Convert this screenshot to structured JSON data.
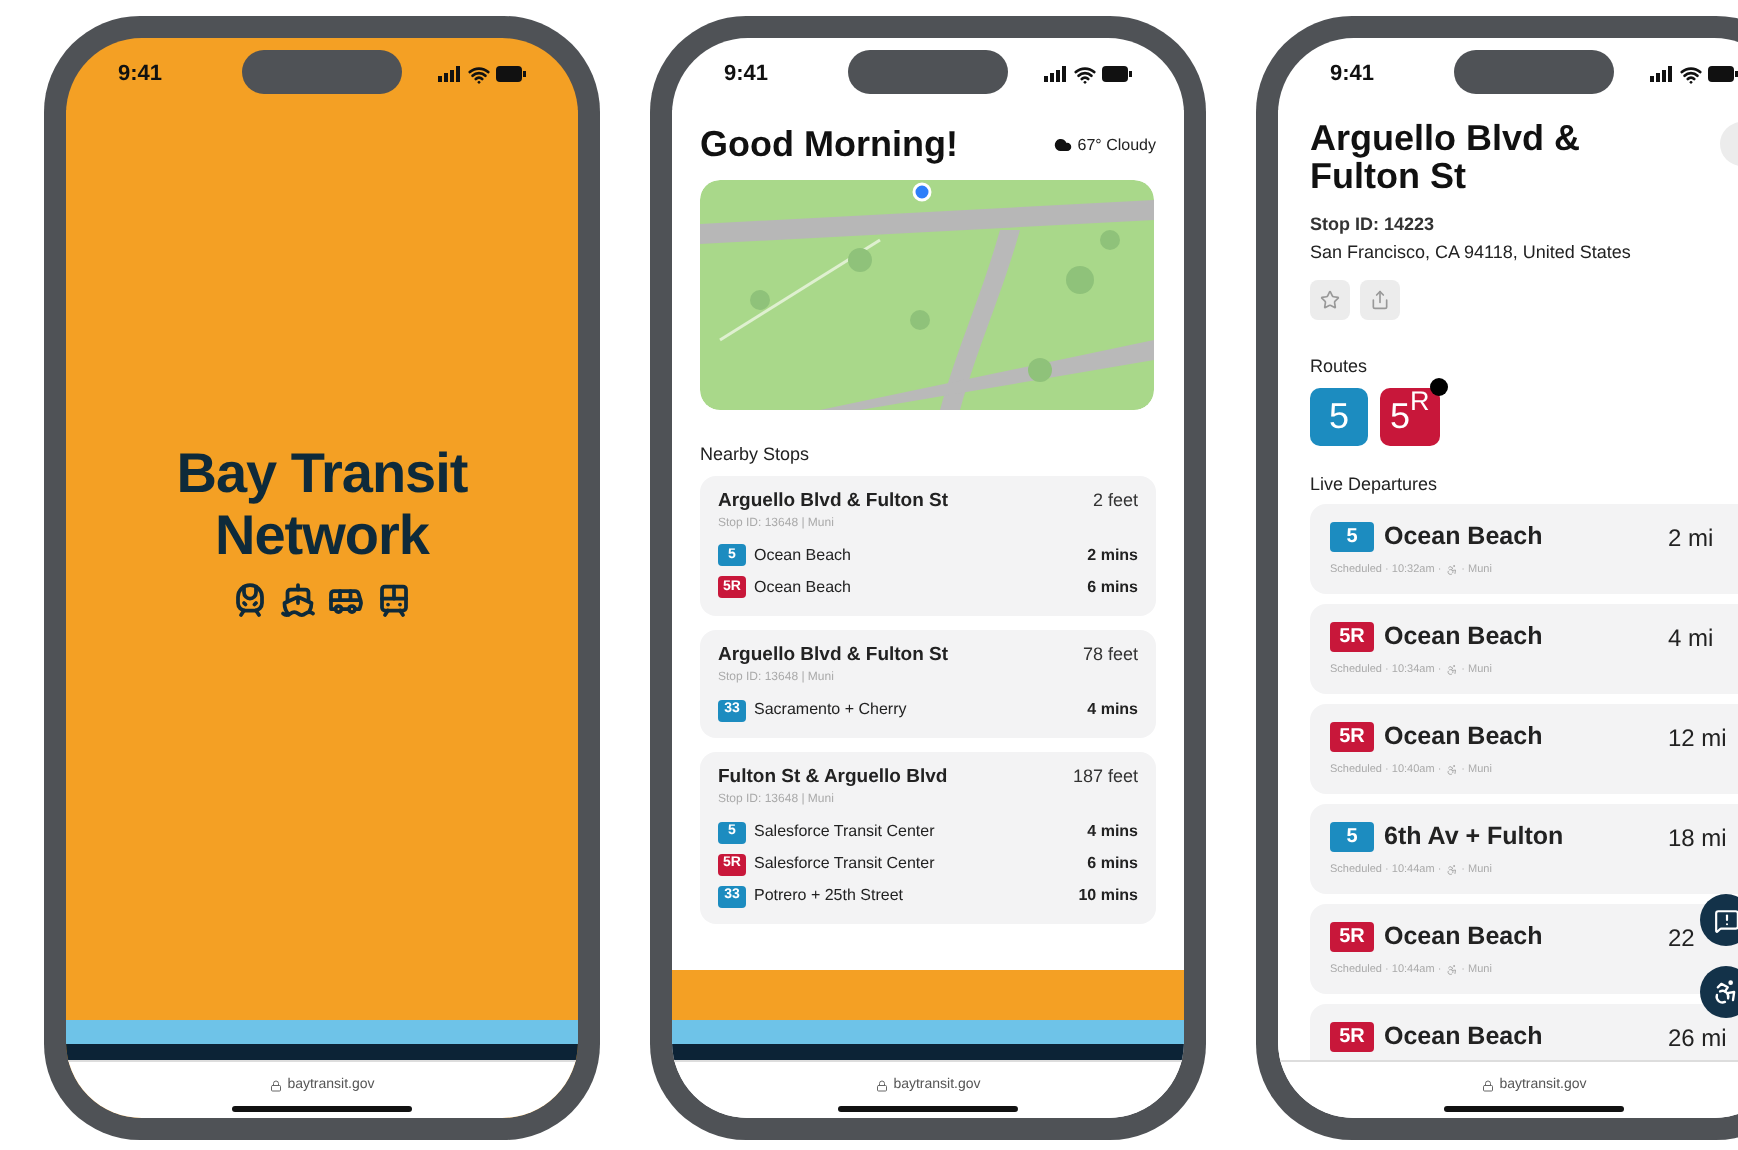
{
  "phones": [
    {
      "kind": "splash",
      "status_time": "9:41",
      "title": "Bay Transit Network",
      "footer": true,
      "url": "baytransit.gov"
    },
    {
      "kind": "home",
      "status_time": "9:41",
      "greeting": "Good Morning!",
      "weather": "67° Cloudy",
      "section_title": "Nearby Stops",
      "footer": true,
      "url": "baytransit.gov",
      "stops": [
        {
          "name": "Arguello Blvd & Fulton St",
          "distance": "2 feet",
          "meta": "Stop ID: 13648 | Muni",
          "routes": [
            {
              "badge": "5",
              "color": "#1c8cc0",
              "destination": "Ocean Beach",
              "eta": "2 mins"
            },
            {
              "badge": "5R",
              "color": "#c8173a",
              "destination": "Ocean Beach",
              "eta": "6 mins"
            }
          ]
        },
        {
          "name": "Arguello Blvd & Fulton St",
          "distance": "78 feet",
          "meta": "Stop ID: 13648 | Muni",
          "routes": [
            {
              "badge": "33",
              "color": "#1c8cc0",
              "destination": "Sacramento + Cherry",
              "eta": "4 mins"
            }
          ]
        },
        {
          "name": "Fulton St & Arguello Blvd",
          "distance": "187 feet",
          "meta": "Stop ID: 13648 | Muni",
          "routes": [
            {
              "badge": "5",
              "color": "#1c8cc0",
              "destination": "Salesforce Transit Center",
              "eta": "4 mins"
            },
            {
              "badge": "5R",
              "color": "#c8173a",
              "destination": "Salesforce Transit Center",
              "eta": "6 mins"
            },
            {
              "badge": "33",
              "color": "#1c8cc0",
              "destination": "Potrero + 25th Street",
              "eta": "10 mins"
            }
          ]
        }
      ]
    },
    {
      "kind": "stop",
      "status_time": "9:41",
      "title": "Arguello Blvd & Fulton St",
      "stop_id": "Stop ID: 14223",
      "address": "San Francisco, CA 94118, United States",
      "routes_label": "Routes",
      "departures_label": "Live Departures",
      "footer": false,
      "url": "baytransit.gov",
      "routes": [
        {
          "badge": "5",
          "color": "#1c8cc0",
          "alert": false
        },
        {
          "badge": "5$^{R}$",
          "color": "#c8173a",
          "alert": true
        }
      ],
      "departures": [
        {
          "badge": "5",
          "color": "#1c8cc0",
          "destination": "Ocean Beach",
          "eta": "2 mi",
          "scheduled": "Scheduled · 10:32am ·",
          "agency": "· Muni"
        },
        {
          "badge": "5R",
          "color": "#c8173a",
          "destination": "Ocean Beach",
          "eta": "4 mi",
          "scheduled": "Scheduled · 10:34am ·",
          "agency": "· Muni"
        },
        {
          "badge": "5R",
          "color": "#c8173a",
          "destination": "Ocean Beach",
          "eta": "12 mi",
          "scheduled": "Scheduled · 10:40am ·",
          "agency": "· Muni"
        },
        {
          "badge": "5",
          "color": "#1c8cc0",
          "destination": "6th Av + Fulton",
          "eta": "18 mi",
          "scheduled": "Scheduled · 10:44am ·",
          "agency": "· Muni"
        },
        {
          "badge": "5R",
          "color": "#c8173a",
          "destination": "Ocean Beach",
          "eta": "22",
          "scheduled": "Scheduled · 10:44am ·",
          "agency": "· Muni"
        },
        {
          "badge": "5R",
          "color": "#c8173a",
          "destination": "Ocean Beach",
          "eta": "26 mi"
        }
      ]
    }
  ]
}
